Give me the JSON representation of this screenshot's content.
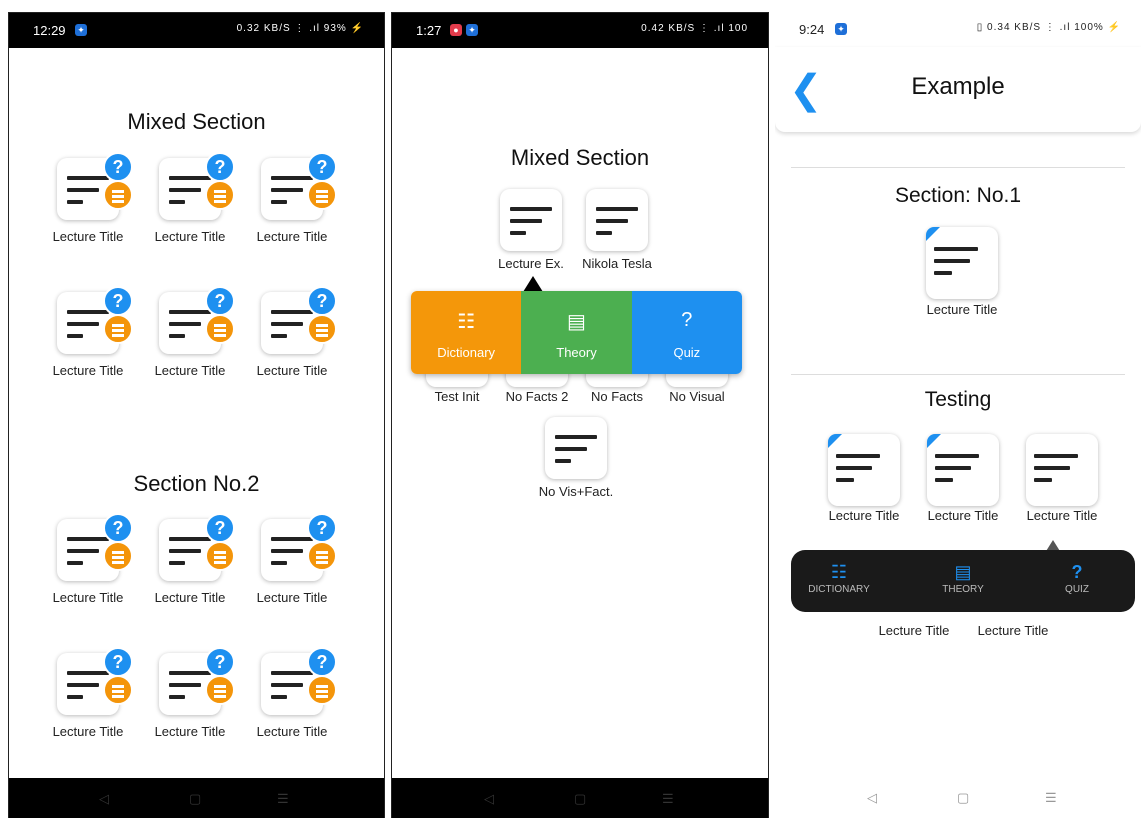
{
  "colors": {
    "accent_blue": "#1e90f0",
    "orange": "#f4950a",
    "green": "#4caf50",
    "blue_btn": "#1e90f0",
    "orange_btn": "#f4970a"
  },
  "screen1": {
    "status": {
      "time": "12:29",
      "right": "0.32 KB/S ⋮ .ıl 93% ⚡"
    },
    "sections": [
      {
        "title": "Mixed Section",
        "labels": [
          "Lecture Title",
          "Lecture Title",
          "Lecture Title",
          "Lecture Title",
          "Lecture Title",
          "Lecture Title"
        ]
      },
      {
        "title": "Section No.2",
        "labels": [
          "Lecture Title",
          "Lecture Title",
          "Lecture Title",
          "Lecture Title",
          "Lecture Title",
          "Lecture Title"
        ]
      }
    ],
    "nav": {
      "back": "◁",
      "home": "▢",
      "recents": "☰"
    }
  },
  "screen2": {
    "status": {
      "time": "1:27",
      "right": "0.42 KB/S ⋮ .ıl 100"
    },
    "title": "Mixed Section",
    "labels_row1": [
      "Lecture Ex.",
      "Nikola Tesla"
    ],
    "labels_row2": [
      "Test Init",
      "No Facts 2",
      "No Facts",
      "No Visual"
    ],
    "label_row3": "No Vis+Fact.",
    "popup": {
      "dictionary": "Dictionary",
      "theory": "Theory",
      "quiz": "Quiz"
    },
    "nav": {
      "back": "◁",
      "home": "▢",
      "recents": "☰"
    }
  },
  "screen3": {
    "status": {
      "time": "9:24",
      "right": "▯ 0.34 KB/S ⋮ .ıl 100% ⚡"
    },
    "header_title": "Example",
    "back_glyph": "❮",
    "section1": "Section: No.1",
    "section1_label": "Lecture Title",
    "section2": "Testing",
    "section2_labels": [
      "Lecture Title",
      "Lecture Title",
      "Lecture Title"
    ],
    "section2_labels_row2": [
      "Lecture Title",
      "Lecture Title"
    ],
    "bar": {
      "dictionary": "DICTIONARY",
      "theory": "THEORY",
      "quiz": "QUIZ"
    },
    "nav": {
      "back": "◁",
      "home": "▢",
      "recents": "☰"
    }
  }
}
